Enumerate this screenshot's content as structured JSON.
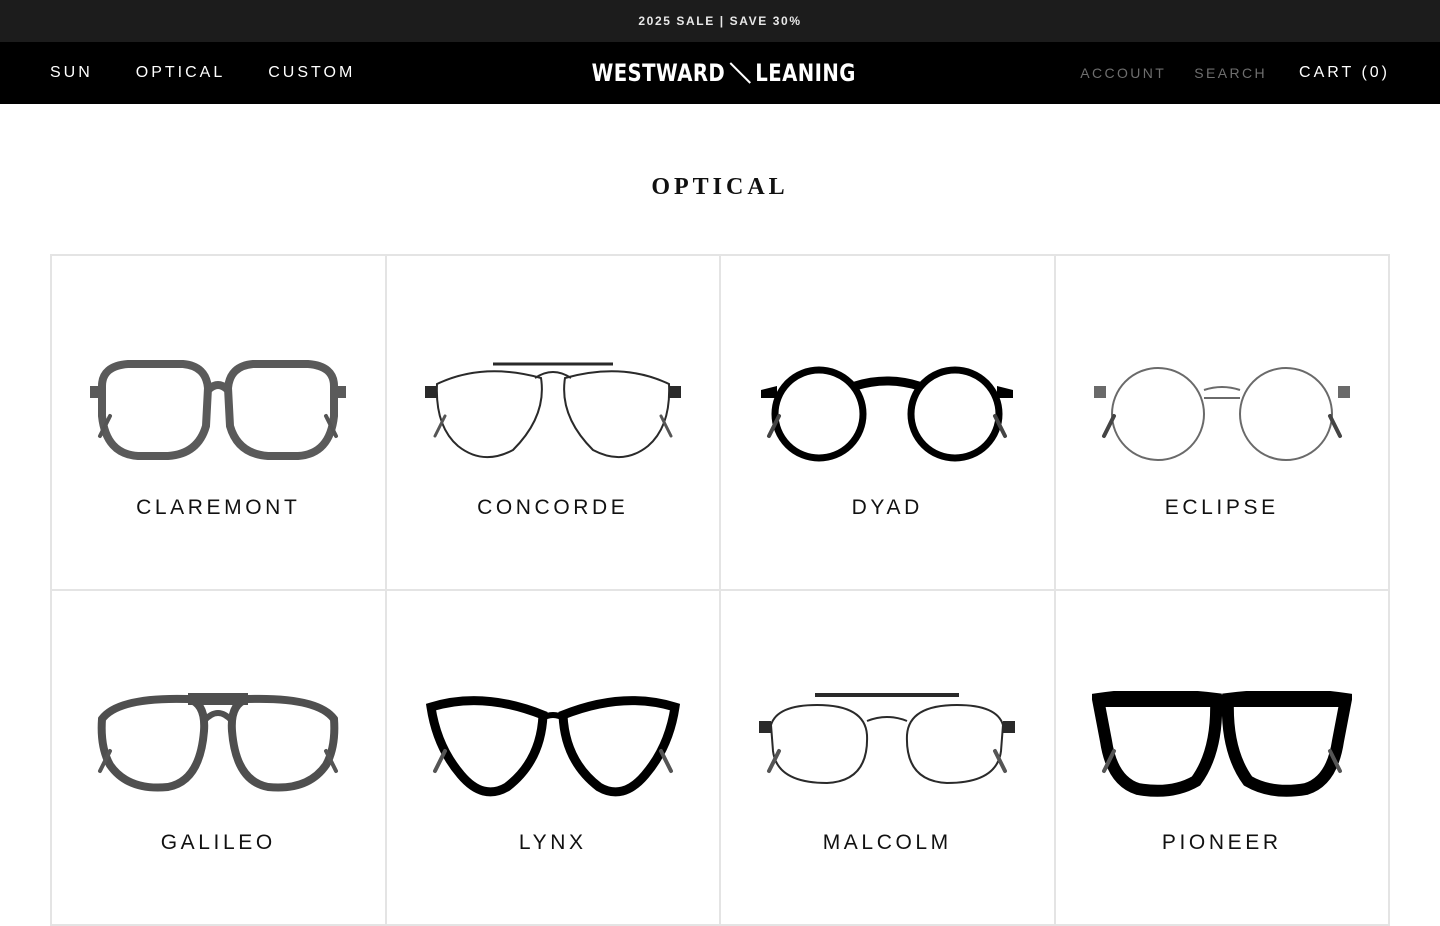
{
  "announcement": "2025 SALE | SAVE 30%",
  "nav": {
    "left": [
      "SUN",
      "OPTICAL",
      "CUSTOM"
    ],
    "brand_left": "WESTWARD",
    "brand_right": "LEANING",
    "account": "ACCOUNT",
    "search": "SEARCH",
    "cart": "CART (0)"
  },
  "page_title": "OPTICAL",
  "products": [
    {
      "name": "CLAREMONT",
      "frame_color": "#5a5a5a",
      "style": "square-acetate"
    },
    {
      "name": "CONCORDE",
      "frame_color": "#2a2a2a",
      "style": "aviator-wire"
    },
    {
      "name": "DYAD",
      "frame_color": "#000000",
      "style": "round-bridge"
    },
    {
      "name": "ECLIPSE",
      "frame_color": "#6a6a6a",
      "style": "round-wire"
    },
    {
      "name": "GALILEO",
      "frame_color": "#4f4f4f",
      "style": "keyhole-acetate"
    },
    {
      "name": "LYNX",
      "frame_color": "#000000",
      "style": "cat-eye"
    },
    {
      "name": "MALCOLM",
      "frame_color": "#2a2a2a",
      "style": "double-bridge"
    },
    {
      "name": "PIONEER",
      "frame_color": "#000000",
      "style": "wayfarer"
    }
  ]
}
